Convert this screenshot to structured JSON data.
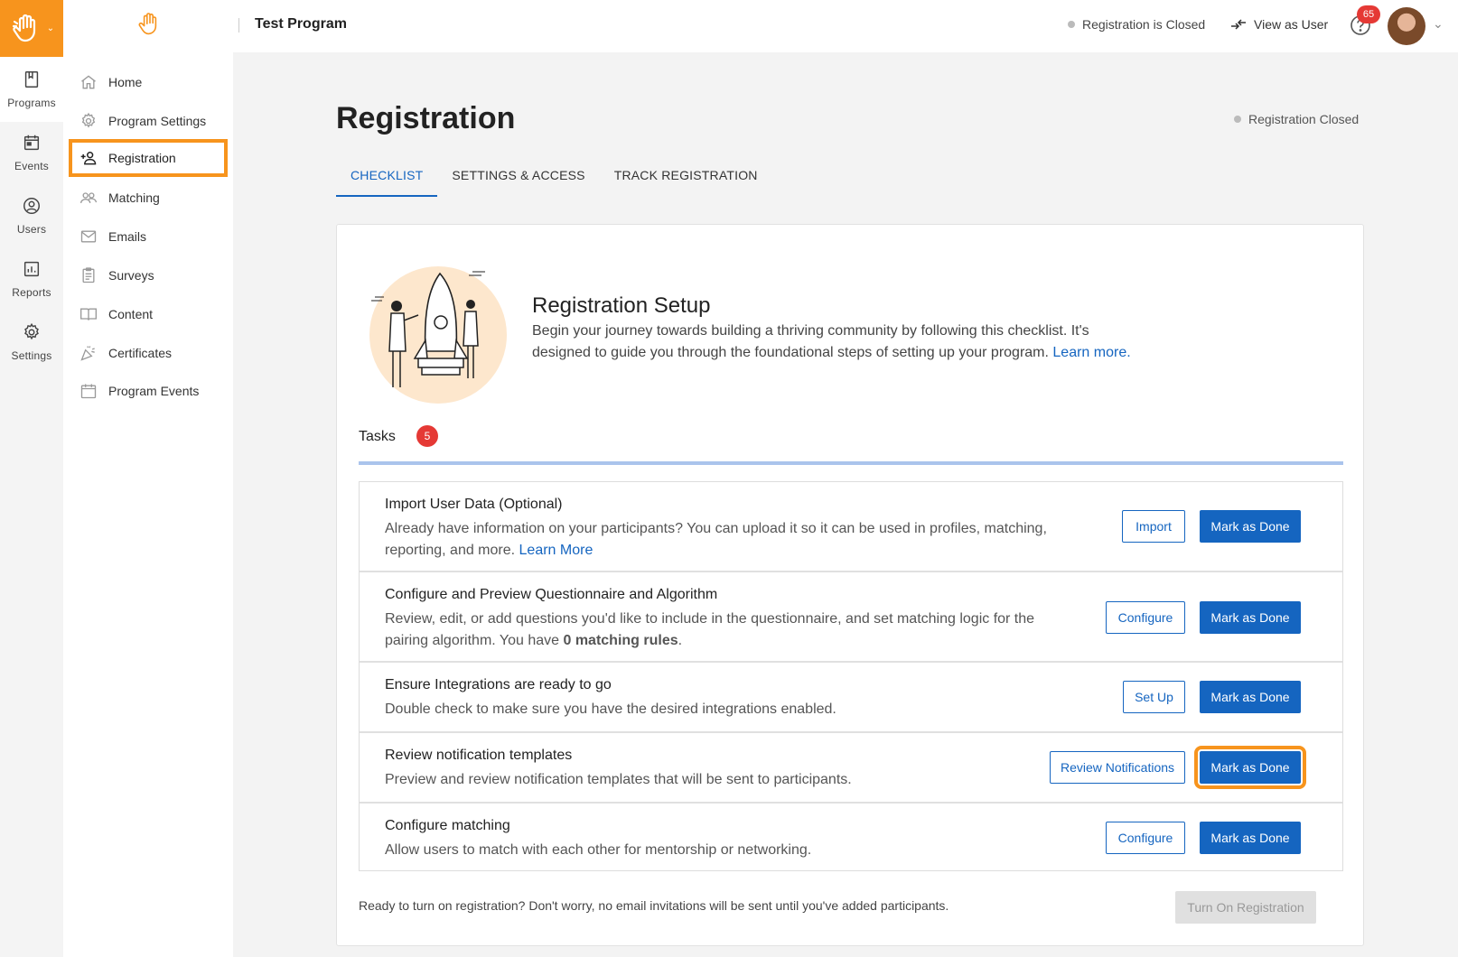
{
  "rail": {
    "items": [
      {
        "label": "Programs",
        "icon": "bookmark-icon"
      },
      {
        "label": "Events",
        "icon": "calendar-icon"
      },
      {
        "label": "Users",
        "icon": "user-circle-icon"
      },
      {
        "label": "Reports",
        "icon": "chart-icon"
      },
      {
        "label": "Settings",
        "icon": "gear-icon"
      }
    ]
  },
  "sidebar": {
    "items": [
      {
        "label": "Home",
        "icon": "home-icon"
      },
      {
        "label": "Program Settings",
        "icon": "gear-icon"
      },
      {
        "label": "Registration",
        "icon": "person-add-icon"
      },
      {
        "label": "Matching",
        "icon": "people-icon"
      },
      {
        "label": "Emails",
        "icon": "mail-icon"
      },
      {
        "label": "Surveys",
        "icon": "clipboard-icon"
      },
      {
        "label": "Content",
        "icon": "book-icon"
      },
      {
        "label": "Certificates",
        "icon": "party-icon"
      },
      {
        "label": "Program Events",
        "icon": "calendar-icon"
      }
    ]
  },
  "topbar": {
    "program_title": "Test Program",
    "registration_status": "Registration is Closed",
    "view_as_user": "View as User",
    "notification_count": "65"
  },
  "main": {
    "title": "Registration",
    "status": "Registration Closed",
    "tabs": [
      {
        "label": "CHECKLIST"
      },
      {
        "label": "SETTINGS & ACCESS"
      },
      {
        "label": "TRACK REGISTRATION"
      }
    ]
  },
  "setup": {
    "title": "Registration Setup",
    "description": "Begin your journey towards building a thriving community by following this checklist. It's designed to guide you through the foundational steps of setting up your program.",
    "learn_more": "Learn more."
  },
  "tasks": {
    "label": "Tasks",
    "count": "5",
    "items": [
      {
        "title": "Import User Data (Optional)",
        "description": "Already have information on your participants? You can upload it so it can be used in profiles, matching, reporting, and more.",
        "link": "Learn More",
        "action": "Import",
        "done": "Mark as Done"
      },
      {
        "title": "Configure and Preview Questionnaire and Algorithm",
        "description_pre": "Review, edit, or add questions you'd like to include in the questionnaire, and set matching logic for the pairing algorithm. You have ",
        "description_bold": "0 matching rules",
        "description_post": ".",
        "action": "Configure",
        "done": "Mark as Done"
      },
      {
        "title": "Ensure Integrations are ready to go",
        "description": "Double check to make sure you have the desired integrations enabled.",
        "action": "Set Up",
        "done": "Mark as Done"
      },
      {
        "title": "Review notification templates",
        "description": "Preview and review notification templates that will be sent to participants.",
        "action": "Review Notifications",
        "done": "Mark as Done"
      },
      {
        "title": "Configure matching",
        "description": "Allow users to match with each other for mentorship or networking.",
        "action": "Configure",
        "done": "Mark as Done"
      }
    ]
  },
  "footer": {
    "note": "Ready to turn on registration? Don't worry, no email invitations will be sent until you've added participants.",
    "turn_on": "Turn On Registration"
  },
  "colors": {
    "brand_orange": "#f7941d",
    "primary_blue": "#1565c0",
    "badge_red": "#e53935"
  }
}
